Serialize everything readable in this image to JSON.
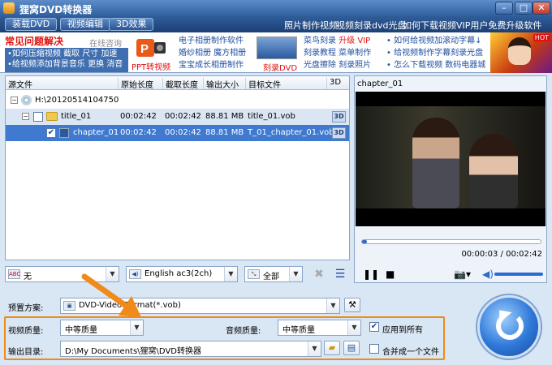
{
  "window": {
    "title": "狸窝DVD转换器"
  },
  "topnav": {
    "buttons": [
      "装载DVD",
      "视频编辑",
      "3D效果"
    ],
    "links": [
      "照片制作视频",
      "视频刻录dvd光盘",
      "如何下载视频",
      "VIP用户免费升级软件"
    ]
  },
  "banner": {
    "faq_title": "常见问题解决",
    "consult": "在线咨询",
    "faq_lines": [
      "•如何压缩视频 截取 尺寸 加速",
      "•给视频添加背景音乐 更换 消音"
    ],
    "ppt_label": "PPT转视频",
    "col1": [
      "电子相册制作软件",
      "婚纱相册 魔方相册",
      "宝宝成长相册制作"
    ],
    "burn_label": "刻录DVD",
    "col2_line1": "菜鸟刻录",
    "col2_red": "升级 VIP",
    "col2": [
      "刻录教程 菜单制作",
      "光盘擦除 刻录照片"
    ],
    "col3": [
      "• 如何给视频加滚动字幕↓",
      "• 给视频制作字幕刻录光盘",
      "• 怎么下载视频 数码电器城"
    ],
    "hot": "HOT"
  },
  "filelist": {
    "headers": [
      "源文件",
      "原始长度",
      "截取长度",
      "输出大小",
      "目标文件",
      "3D"
    ],
    "disc": {
      "name": "H:\\20120514104750"
    },
    "title": {
      "name": "title_01",
      "orig": "00:02:42",
      "cut": "00:02:42",
      "size": "88.81 MB",
      "target": "title_01.vob"
    },
    "chapter": {
      "name": "chapter_01",
      "orig": "00:02:42",
      "cut": "00:02:42",
      "size": "88.81 MB",
      "target": "T_01_chapter_01.vob"
    }
  },
  "controls": {
    "subtitle": "无",
    "audio_track": "English ac3(2ch)",
    "crop": "全部"
  },
  "preview": {
    "title": "chapter_01",
    "time": "00:00:03 / 00:02:42",
    "progress": 0.02,
    "volume": 1.0
  },
  "settings": {
    "preset_label": "预置方案:",
    "preset_value": "DVD-Video Format(*.vob)",
    "video_quality_label": "视频质量:",
    "video_quality": "中等质量",
    "audio_quality_label": "音频质量:",
    "audio_quality": "中等质量",
    "apply_all": "应用到所有",
    "output_label": "输出目录:",
    "output_path": "D:\\My Documents\\狸窝\\DVD转换器",
    "merge": "合并成一个文件"
  },
  "colors": {
    "accent": "#3f79d0",
    "highlight": "#f08a1a",
    "red": "#e0120f"
  }
}
